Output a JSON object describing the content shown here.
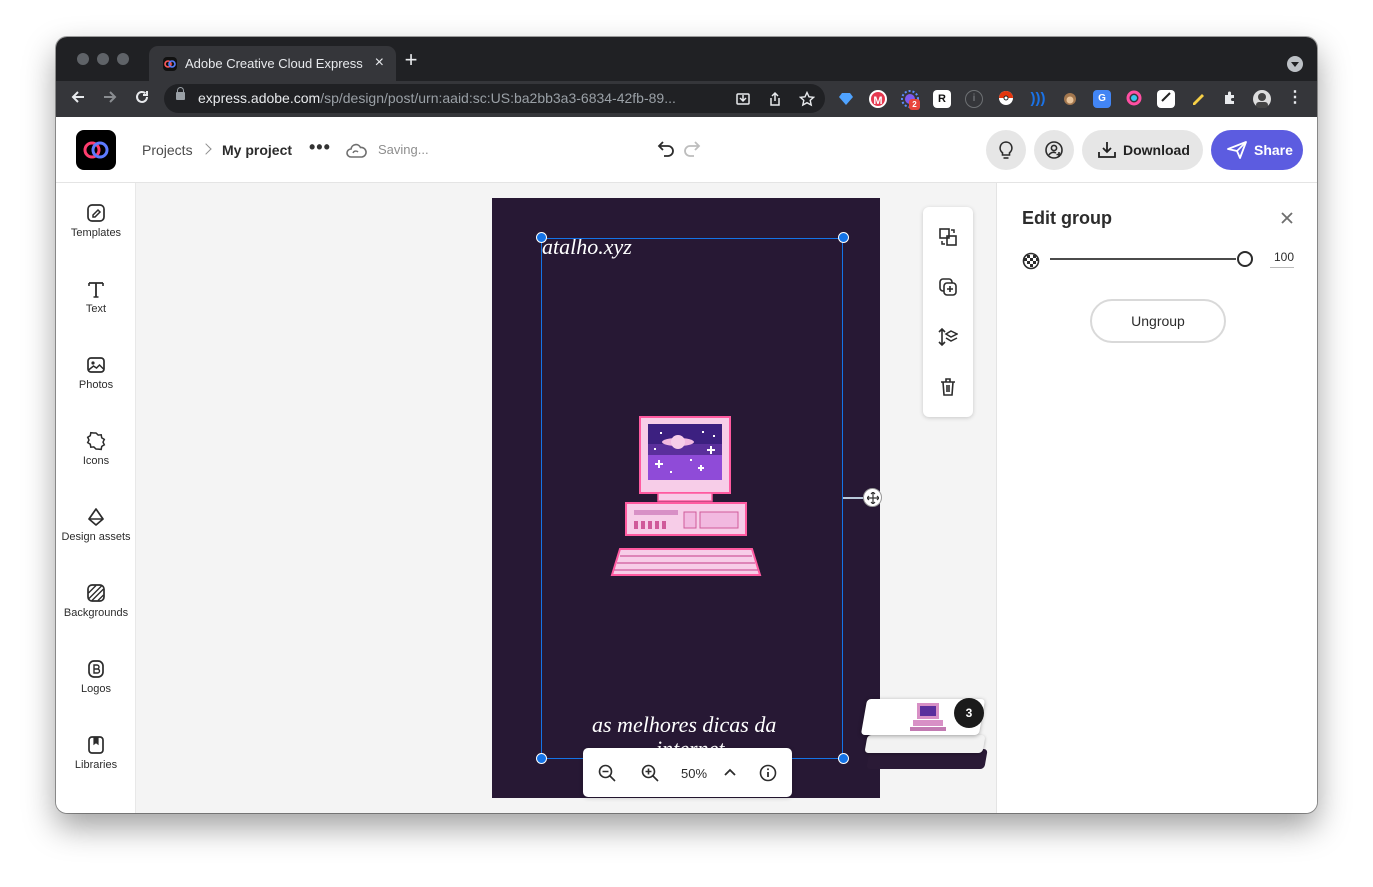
{
  "browser": {
    "tab_title": "Adobe Creative Cloud Express",
    "new_tab": "+",
    "url_host": "express.adobe.com",
    "url_path": "/sp/design/post/urn:aaid:sc:US:ba2bb3a3-6834-42fb-89...",
    "extension_badge": "2"
  },
  "header": {
    "breadcrumb_root": "Projects",
    "project_name": "My project",
    "status": "Saving...",
    "download_label": "Download",
    "share_label": "Share",
    "share_color": "#5c5ce0"
  },
  "sidebar": {
    "items": [
      {
        "label": "Templates",
        "icon": "templates-icon"
      },
      {
        "label": "Text",
        "icon": "text-icon"
      },
      {
        "label": "Photos",
        "icon": "photos-icon"
      },
      {
        "label": "Icons",
        "icon": "icons-icon"
      },
      {
        "label": "Design assets",
        "icon": "design-assets-icon"
      },
      {
        "label": "Backgrounds",
        "icon": "backgrounds-icon"
      },
      {
        "label": "Logos",
        "icon": "logos-icon"
      },
      {
        "label": "Libraries",
        "icon": "libraries-icon"
      }
    ]
  },
  "canvas": {
    "top_text": "atalho.xyz",
    "bottom_text_line1": "as melhores dicas da",
    "bottom_text_line2": "internet",
    "background_color": "#271834",
    "selection_color": "#1473e6",
    "zoom": "50%",
    "page_count": "3"
  },
  "panel": {
    "title": "Edit group",
    "opacity_value": "100",
    "opacity_level": 1.0,
    "ungroup_label": "Ungroup"
  }
}
